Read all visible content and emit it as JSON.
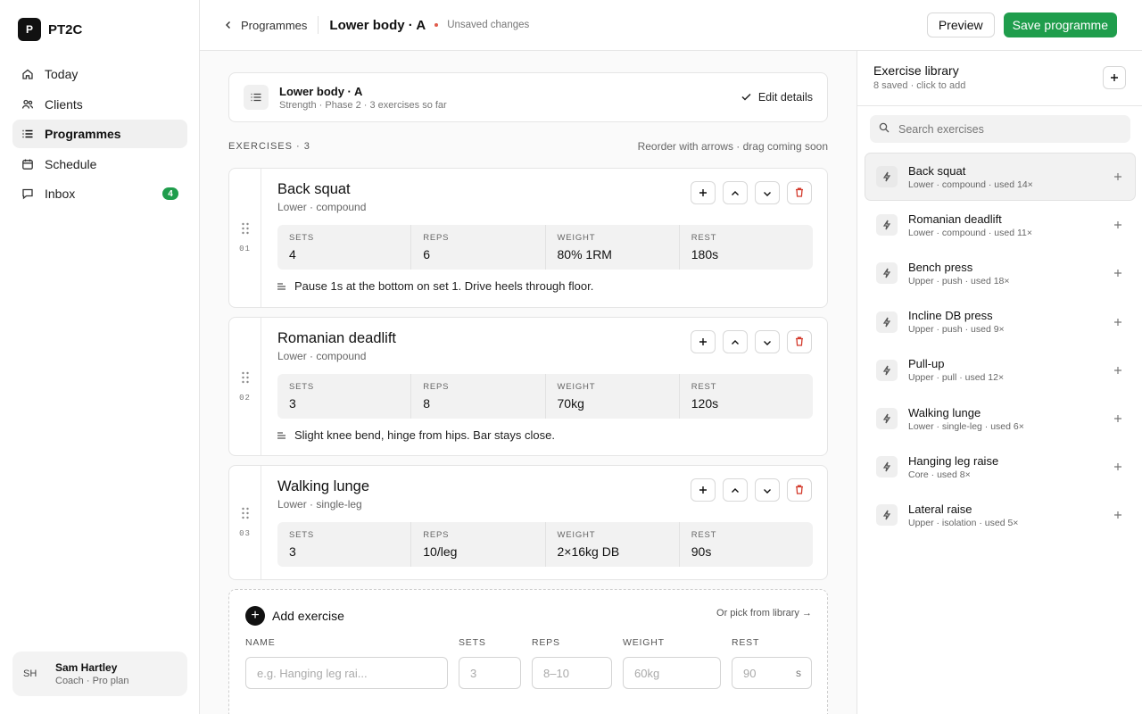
{
  "brand": {
    "logo_letter": "P",
    "name": "PT2C"
  },
  "nav": [
    {
      "label": "Today",
      "icon": "home-icon",
      "active": false
    },
    {
      "label": "Clients",
      "icon": "users-icon",
      "active": false
    },
    {
      "label": "Programmes",
      "icon": "list-icon",
      "active": true
    },
    {
      "label": "Schedule",
      "icon": "calendar-icon",
      "active": false
    },
    {
      "label": "Inbox",
      "icon": "chat-icon",
      "active": false,
      "badge": "4"
    }
  ],
  "user": {
    "initials": "SH",
    "name": "Sam Hartley",
    "subtitle": "Coach · Pro plan"
  },
  "topbar": {
    "back_label": "Programmes",
    "title": "Lower body · A",
    "status": "Unsaved changes",
    "preview_label": "Preview",
    "save_label": "Save programme"
  },
  "programme": {
    "title": "Lower body · A",
    "subtitle": "Strength · Phase 2 · 3 exercises so far",
    "edit_label": "Edit details"
  },
  "exercises_header": {
    "label": "EXERCISES · 3",
    "hint": "Reorder with arrows · drag coming soon"
  },
  "stat_labels": {
    "sets": "SETS",
    "reps": "REPS",
    "weight": "WEIGHT",
    "rest": "REST"
  },
  "exercises": [
    {
      "num": "01",
      "name": "Back squat",
      "tag": "Lower · compound",
      "sets": "4",
      "reps": "6",
      "weight": "80% 1RM",
      "rest": "180s",
      "note": "Pause 1s at the bottom on set 1. Drive heels through floor."
    },
    {
      "num": "02",
      "name": "Romanian deadlift",
      "tag": "Lower · compound",
      "sets": "3",
      "reps": "8",
      "weight": "70kg",
      "rest": "120s",
      "note": "Slight knee bend, hinge from hips. Bar stays close."
    },
    {
      "num": "03",
      "name": "Walking lunge",
      "tag": "Lower · single-leg",
      "sets": "3",
      "reps": "10/leg",
      "weight": "2×16kg DB",
      "rest": "90s",
      "note": ""
    }
  ],
  "add_exercise": {
    "title": "Add exercise",
    "pick_label": "Or pick from library →",
    "labels": {
      "name": "NAME",
      "sets": "SETS",
      "reps": "REPS",
      "weight": "WEIGHT",
      "rest": "REST"
    },
    "placeholders": {
      "name": "e.g. Hanging leg rai...",
      "sets": "3",
      "reps": "8–10",
      "weight": "60kg",
      "rest": "90"
    },
    "rest_unit": "s"
  },
  "library": {
    "title": "Exercise library",
    "subtitle": "8 saved · click to add",
    "search_placeholder": "Search exercises",
    "items": [
      {
        "name": "Back squat",
        "meta": "Lower · compound · used 14×"
      },
      {
        "name": "Romanian deadlift",
        "meta": "Lower · compound · used 11×"
      },
      {
        "name": "Bench press",
        "meta": "Upper · push · used 18×"
      },
      {
        "name": "Incline DB press",
        "meta": "Upper · push · used 9×"
      },
      {
        "name": "Pull-up",
        "meta": "Upper · pull · used 12×"
      },
      {
        "name": "Walking lunge",
        "meta": "Lower · single-leg · used 6×"
      },
      {
        "name": "Hanging leg raise",
        "meta": "Core · used 8×"
      },
      {
        "name": "Lateral raise",
        "meta": "Upper · isolation · used 5×"
      }
    ]
  },
  "colors": {
    "accent": "#1f9d4c",
    "danger": "#d33a2c",
    "status_dot": "#e05b4b"
  }
}
